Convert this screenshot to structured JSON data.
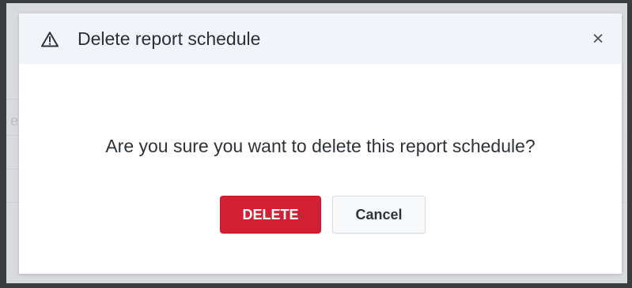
{
  "background": {
    "partial_text": "e"
  },
  "dialog": {
    "title": "Delete report schedule",
    "close_symbol": "×",
    "message": "Are you sure you want to delete this report schedule?",
    "buttons": {
      "delete_label": "DELETE",
      "cancel_label": "Cancel"
    },
    "icons": {
      "title_icon": "warning-icon",
      "close_icon": "close-icon"
    },
    "colors": {
      "header_background": "#f1f4f8",
      "danger": "#d21f34",
      "secondary_button": "#f8f9fa",
      "text": "#2f3338"
    }
  }
}
